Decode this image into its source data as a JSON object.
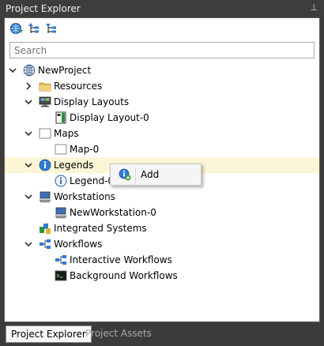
{
  "panel": {
    "title": "Project Explorer",
    "pin_glyph": "⊥"
  },
  "toolbar": [
    {
      "icon": "refresh-globe-icon"
    },
    {
      "icon": "collapse-tree-icon"
    },
    {
      "icon": "expand-tree-icon"
    }
  ],
  "search": {
    "placeholder": "Search",
    "value": ""
  },
  "tree": {
    "root": "NewProject",
    "resources": "Resources",
    "display_layouts": "Display Layouts",
    "display_layout_0": "Display Layout-0",
    "maps": "Maps",
    "map_0": "Map-0",
    "legends": "Legends",
    "legend_0": "Legend-0",
    "workstations": "Workstations",
    "new_workstation_0": "NewWorkstation-0",
    "integrated_systems": "Integrated Systems",
    "workflows": "Workflows",
    "interactive_workflows": "Interactive Workflows",
    "background_workflows": "Background Workflows"
  },
  "context_menu": {
    "add_label": "Add"
  },
  "tabs": {
    "active": "Project Explorer",
    "inactive": "Project Assets"
  },
  "colors": {
    "highlight": "#fdf6d6",
    "chrome": "#3b3b3b",
    "accent": "#2f7bd3"
  }
}
